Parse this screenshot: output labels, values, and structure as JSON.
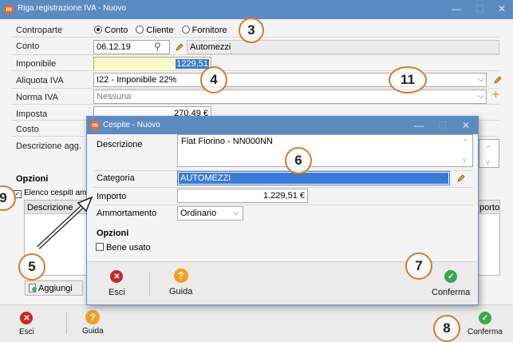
{
  "main": {
    "title": "Riga registrazione IVA - Nuovo",
    "controparte": {
      "label": "Controparte",
      "options": [
        "Conto",
        "Cliente",
        "Fornitore"
      ],
      "selected": "Conto"
    },
    "conto": {
      "label": "Conto",
      "value": "06.12.19",
      "description": "Automezzi"
    },
    "imponibile": {
      "label": "Imponibile",
      "value": "1229,51"
    },
    "aliquota": {
      "label": "Aliquota IVA",
      "value": "I22 - Imponibile 22%"
    },
    "norma": {
      "label": "Norma IVA",
      "value": "Nessuna"
    },
    "imposta": {
      "label": "Imposta",
      "value": "270,49 €"
    },
    "costo": {
      "label": "Costo"
    },
    "descrizione_agg": {
      "label": "Descrizione agg."
    },
    "opzioni_label": "Opzioni",
    "elenco_label": "Elenco cespiti amm",
    "table": {
      "col_descrizione": "Descrizione",
      "col_importo": "porto"
    },
    "aggiungi_label": "Aggiungi",
    "footer": {
      "esci": "Esci",
      "guida": "Guida",
      "conferma": "Conferma"
    }
  },
  "dialog": {
    "title": "Cespite - Nuovo",
    "descrizione": {
      "label": "Descrizione",
      "value": "Fiat Fiorino - NN000NN"
    },
    "categoria": {
      "label": "Categoria",
      "value": "AUTOMEZZI"
    },
    "importo": {
      "label": "Importo",
      "value": "1.229,51 €"
    },
    "ammortamento": {
      "label": "Ammortamento",
      "value": "Ordinario"
    },
    "opzioni_label": "Opzioni",
    "bene_usato_label": "Bene usato",
    "footer": {
      "esci": "Esci",
      "guida": "Guida",
      "conferma": "Conferma"
    }
  },
  "badges": [
    "3",
    "4",
    "11",
    "6",
    "9",
    "5",
    "7",
    "8"
  ],
  "colors": {
    "titlebar": "#5c8bc2",
    "badge_border": "#d97a2b",
    "selection": "#3a7bd5",
    "imponibile_bg": "#fdf8c6"
  }
}
